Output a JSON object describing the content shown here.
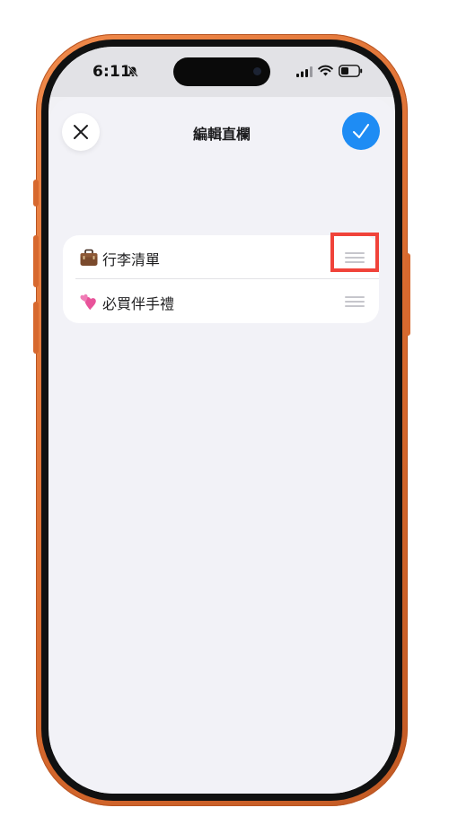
{
  "status_bar": {
    "time": "6:11",
    "icons": [
      "silent-mode-icon",
      "signal-icon",
      "wifi-icon",
      "battery-icon"
    ]
  },
  "header": {
    "title": "編輯直欄",
    "close_icon": "close-icon",
    "done_icon": "checkmark-icon"
  },
  "columns": [
    {
      "emoji": "💼",
      "emoji_icon": "briefcase-icon",
      "label": "行李清單",
      "handle_icon": "drag-handle-icon"
    },
    {
      "emoji": "💕",
      "emoji_icon": "two-hearts-icon",
      "label": "必買伴手禮",
      "handle_icon": "drag-handle-icon"
    }
  ],
  "colors": {
    "frame": "#e07636",
    "accent": "#1e8cf4",
    "highlight": "#f0433a",
    "background": "#f2f2f7"
  }
}
